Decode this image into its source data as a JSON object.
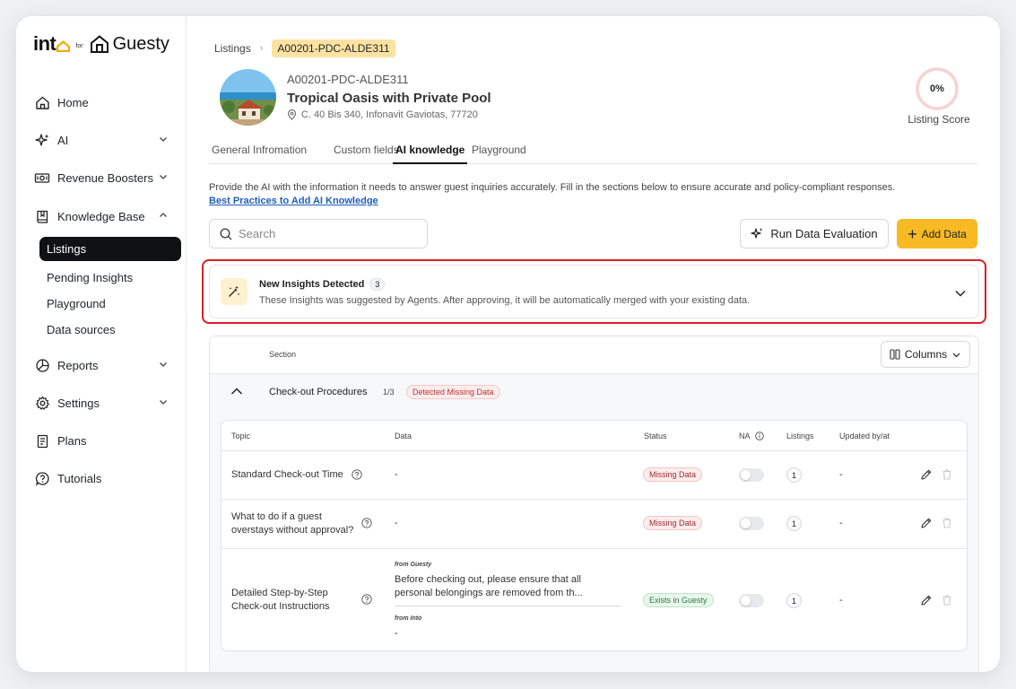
{
  "brand": {
    "into": "int",
    "for": "for",
    "guesty": "Guesty"
  },
  "sidebar": {
    "home": "Home",
    "ai": "AI",
    "revenue": "Revenue Boosters",
    "knowledge": "Knowledge Base",
    "sub": [
      "Listings",
      "Pending Insights",
      "Playground",
      "Data sources"
    ],
    "reports": "Reports",
    "settings": "Settings",
    "plans": "Plans",
    "tutorials": "Tutorials"
  },
  "breadcrumb": {
    "root": "Listings",
    "current": "A00201-PDC-ALDE311"
  },
  "listing": {
    "code": "A00201-PDC-ALDE311",
    "title": "Tropical Oasis with Private Pool",
    "address": "C. 40 Bis 340, Infonavit Gaviotas, 77720",
    "score": "0%",
    "score_label": "Listing Score"
  },
  "tabs": [
    "General Infromation",
    "Custom fields",
    "AI knowledge",
    "Playground"
  ],
  "intro": {
    "text": "Provide the AI with the information it needs to answer guest inquiries accurately. Fill in the sections below to ensure accurate and policy-compliant responses.",
    "link": "Best Practices to Add AI Knowledge"
  },
  "toolbar": {
    "search_placeholder": "Search",
    "eval_label": "Run Data Evaluation",
    "add_label": "Add Data"
  },
  "insights": {
    "title": "New Insights Detected",
    "count": "3",
    "desc": "These Insights was suggested by Agents. After approving, it will be automatically merged with your existing data."
  },
  "table": {
    "section_header": "Section",
    "columns_label": "Columns",
    "group": {
      "name": "Check-out Procedures",
      "fraction": "1/3",
      "badge": "Detected Missing Data"
    },
    "headers": {
      "topic": "Topic",
      "data": "Data",
      "status": "Status",
      "na": "NA",
      "listings": "Listings",
      "updated": "Updated by/at"
    },
    "rows": [
      {
        "topic": "Standard Check-out Time",
        "data": "-",
        "status": "Missing Data",
        "listings": "1",
        "updated": "-"
      },
      {
        "topic_l1": "What to do if a guest",
        "topic_l2": "overstays without approval?",
        "data": "-",
        "status": "Missing Data",
        "listings": "1",
        "updated": "-"
      },
      {
        "topic_l1": "Detailed Step-by-Step",
        "topic_l2": "Check-out Instructions",
        "from_guesty": "from Guesty",
        "guesty_l1": "Before checking out, please ensure that all",
        "guesty_l2": "personal belongings are removed from th...",
        "from_into": "from Into",
        "into_val": "-",
        "status": "Exists in Guesty",
        "listings": "1",
        "updated": "-"
      }
    ]
  },
  "colors": {
    "accent": "#f7b924",
    "highlight": "#d81f26",
    "link": "#1d5fb8"
  }
}
